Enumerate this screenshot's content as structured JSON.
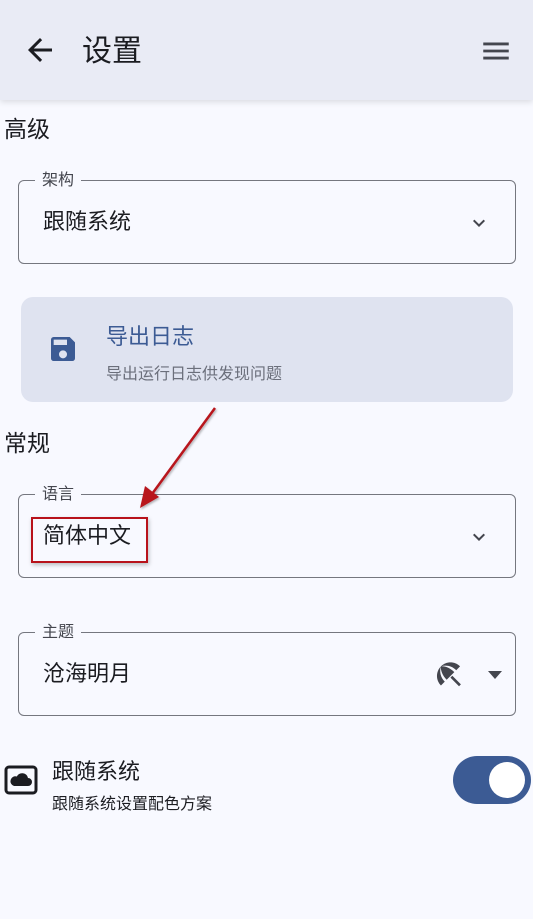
{
  "header": {
    "title": "设置",
    "back_icon": "arrow-left-icon",
    "menu_icon": "hamburger-menu-icon"
  },
  "advanced": {
    "section_title": "高级",
    "architecture": {
      "label": "架构",
      "value": "跟随系统"
    },
    "export_log": {
      "title": "导出日志",
      "subtitle": "导出运行日志供发现问题",
      "icon": "save-icon"
    }
  },
  "general": {
    "section_title": "常规",
    "language": {
      "label": "语言",
      "value": "简体中文"
    },
    "theme": {
      "label": "主题",
      "value": "沧海明月",
      "icon": "umbrella-icon"
    },
    "follow_system": {
      "title": "跟随系统",
      "subtitle": "跟随系统设置配色方案",
      "enabled": true,
      "icon": "cloud-icon"
    }
  },
  "colors": {
    "accent": "#3c5b94",
    "annotation": "#b8121b",
    "appbar": "#e9ebf5",
    "card": "#dfe3f0"
  }
}
